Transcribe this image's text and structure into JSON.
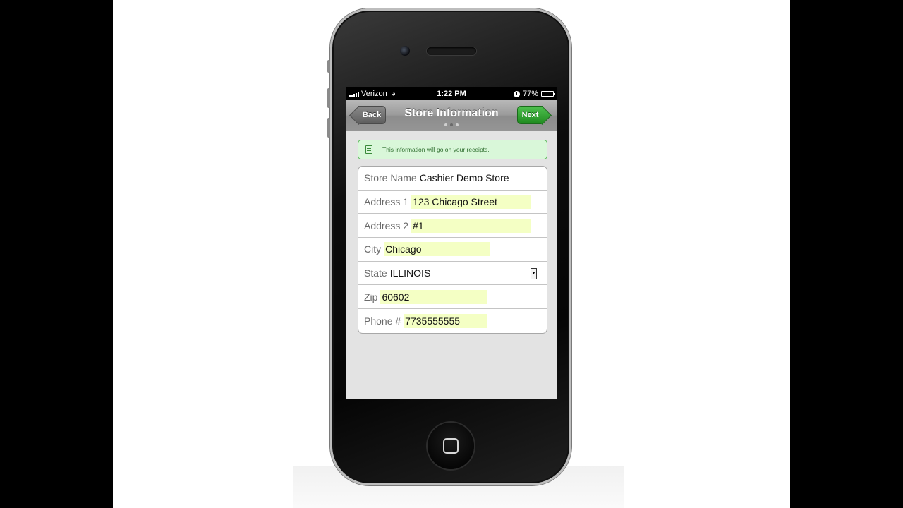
{
  "status_bar": {
    "carrier": "Verizon",
    "time": "1:22 PM",
    "battery": "77%",
    "battery_level": 0.77
  },
  "nav": {
    "back_label": "Back",
    "title": "Store Information",
    "next_label": "Next",
    "page_count": 3,
    "active_page": 2
  },
  "banner": {
    "icon": "receipt-icon",
    "text": "This information will go on your receipts."
  },
  "form": {
    "store_name": {
      "label": "Store Name",
      "value": "Cashier Demo Store"
    },
    "address1": {
      "label": "Address 1",
      "value": "123 Chicago Street"
    },
    "address2": {
      "label": "Address 2",
      "value": "#1"
    },
    "city": {
      "label": "City",
      "value": "Chicago"
    },
    "state": {
      "label": "State",
      "value": "ILLINOIS"
    },
    "zip": {
      "label": "Zip",
      "value": "60602"
    },
    "phone": {
      "label": "Phone #",
      "value": "7735555555"
    }
  },
  "colors": {
    "field_highlight": "#f4ffc4",
    "next_button": "#2f9e2f",
    "banner_background": "#d9f7d9",
    "banner_border": "#5cb85c"
  }
}
